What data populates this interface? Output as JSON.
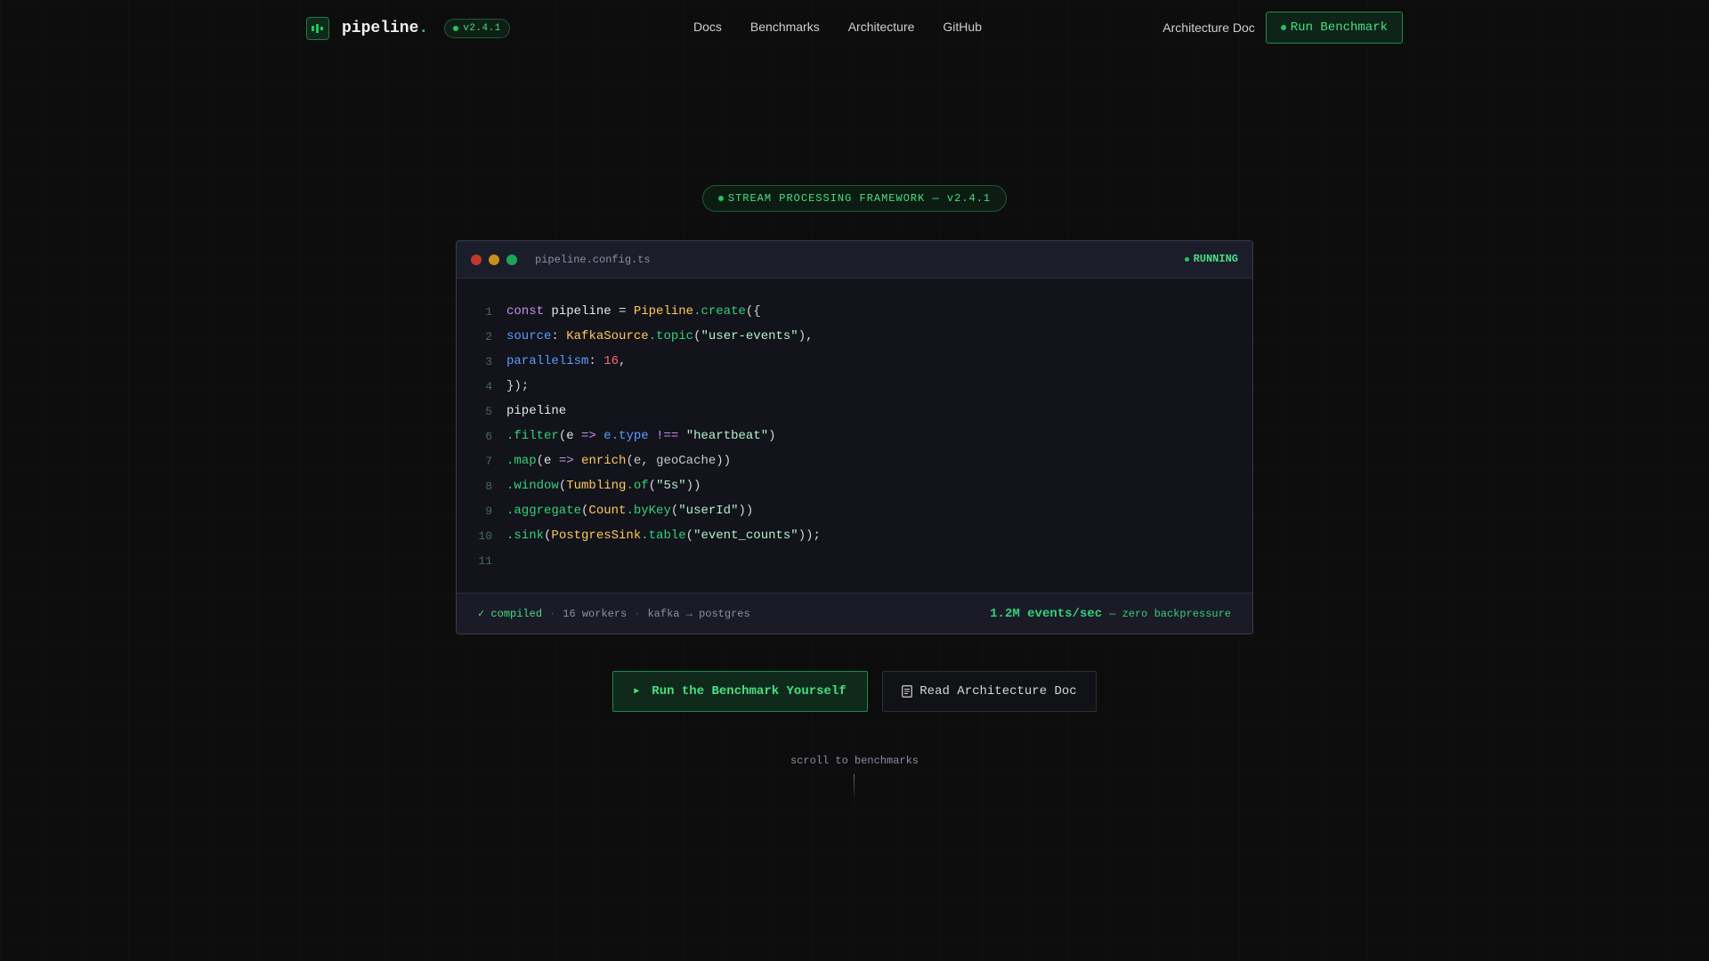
{
  "nav": {
    "brand": "pipeline",
    "brand_dot": ".",
    "version": "v2.4.1",
    "links": [
      "Docs",
      "Benchmarks",
      "Architecture",
      "GitHub"
    ],
    "doc_link": "Architecture Doc",
    "run_button": "Run Benchmark"
  },
  "hero": {
    "badge": "STREAM PROCESSING FRAMEWORK — v2.4.1"
  },
  "editor": {
    "filename": "pipeline.config.ts",
    "status": "RUNNING",
    "line_numbers": [
      "1",
      "2",
      "3",
      "4",
      "5",
      "6",
      "7",
      "8",
      "9",
      "10",
      "11"
    ],
    "lines": [
      [
        [
          "kw",
          "const"
        ],
        [
          "id",
          " pipeline "
        ],
        [
          "op",
          "= "
        ],
        [
          "cls",
          "Pipeline"
        ],
        [
          "fn",
          ".create"
        ],
        [
          "punc",
          "({"
        ]
      ],
      [
        [
          "prop",
          "source"
        ],
        [
          "punc",
          ": "
        ],
        [
          "cls",
          "KafkaSource"
        ],
        [
          "fn",
          ".topic"
        ],
        [
          "punc",
          "("
        ],
        [
          "str",
          "\"user-events\""
        ],
        [
          "punc",
          "),"
        ]
      ],
      [
        [
          "prop",
          "parallelism"
        ],
        [
          "punc",
          ": "
        ],
        [
          "num",
          "16"
        ],
        [
          "punc",
          ","
        ]
      ],
      [
        [
          "punc",
          "});"
        ]
      ],
      [
        [
          "id",
          "pipeline"
        ]
      ],
      [
        [
          "fn",
          ".filter"
        ],
        [
          "punc",
          "("
        ],
        [
          "id",
          "e "
        ],
        [
          "arrow",
          "=>"
        ],
        [
          "id",
          " "
        ],
        [
          "prop",
          "e.type"
        ],
        [
          "id",
          " "
        ],
        [
          "kw",
          "!=="
        ],
        [
          "id",
          " "
        ],
        [
          "str",
          "\"heartbeat\""
        ],
        [
          "punc",
          ")"
        ]
      ],
      [
        [
          "fn",
          ".map"
        ],
        [
          "punc",
          "("
        ],
        [
          "id",
          "e "
        ],
        [
          "arrow",
          "=>"
        ],
        [
          "id",
          " "
        ],
        [
          "cls",
          "enrich"
        ],
        [
          "punc",
          "("
        ],
        [
          "param",
          "e, geoCache"
        ],
        [
          "punc",
          "))"
        ]
      ],
      [
        [
          "fn",
          ".window"
        ],
        [
          "punc",
          "("
        ],
        [
          "cls",
          "Tumbling"
        ],
        [
          "fn",
          ".of"
        ],
        [
          "punc",
          "("
        ],
        [
          "str",
          "\"5s\""
        ],
        [
          "punc",
          "))"
        ]
      ],
      [
        [
          "fn",
          ".aggregate"
        ],
        [
          "punc",
          "("
        ],
        [
          "cls",
          "Count"
        ],
        [
          "fn",
          ".byKey"
        ],
        [
          "punc",
          "("
        ],
        [
          "str",
          "\"userId\""
        ],
        [
          "punc",
          "))"
        ]
      ],
      [
        [
          "fn",
          ".sink"
        ],
        [
          "punc",
          "("
        ],
        [
          "cls",
          "PostgresSink"
        ],
        [
          "fn",
          ".table"
        ],
        [
          "punc",
          "("
        ],
        [
          "str",
          "\"event_counts\""
        ],
        [
          "punc",
          "));"
        ]
      ],
      []
    ],
    "footer": {
      "compiled": "✓ compiled",
      "workers": "16 workers",
      "route": "kafka → postgres",
      "throughput": "1.2M events/sec",
      "throughput_note": "— zero backpressure"
    }
  },
  "cta": {
    "primary": "Run the Benchmark Yourself",
    "secondary": "Read Architecture Doc"
  },
  "scroll_hint": "scroll to benchmarks",
  "colors": {
    "accent": "#22c55e",
    "background": "#0d0d0e",
    "editor_bg": "#12131b"
  }
}
